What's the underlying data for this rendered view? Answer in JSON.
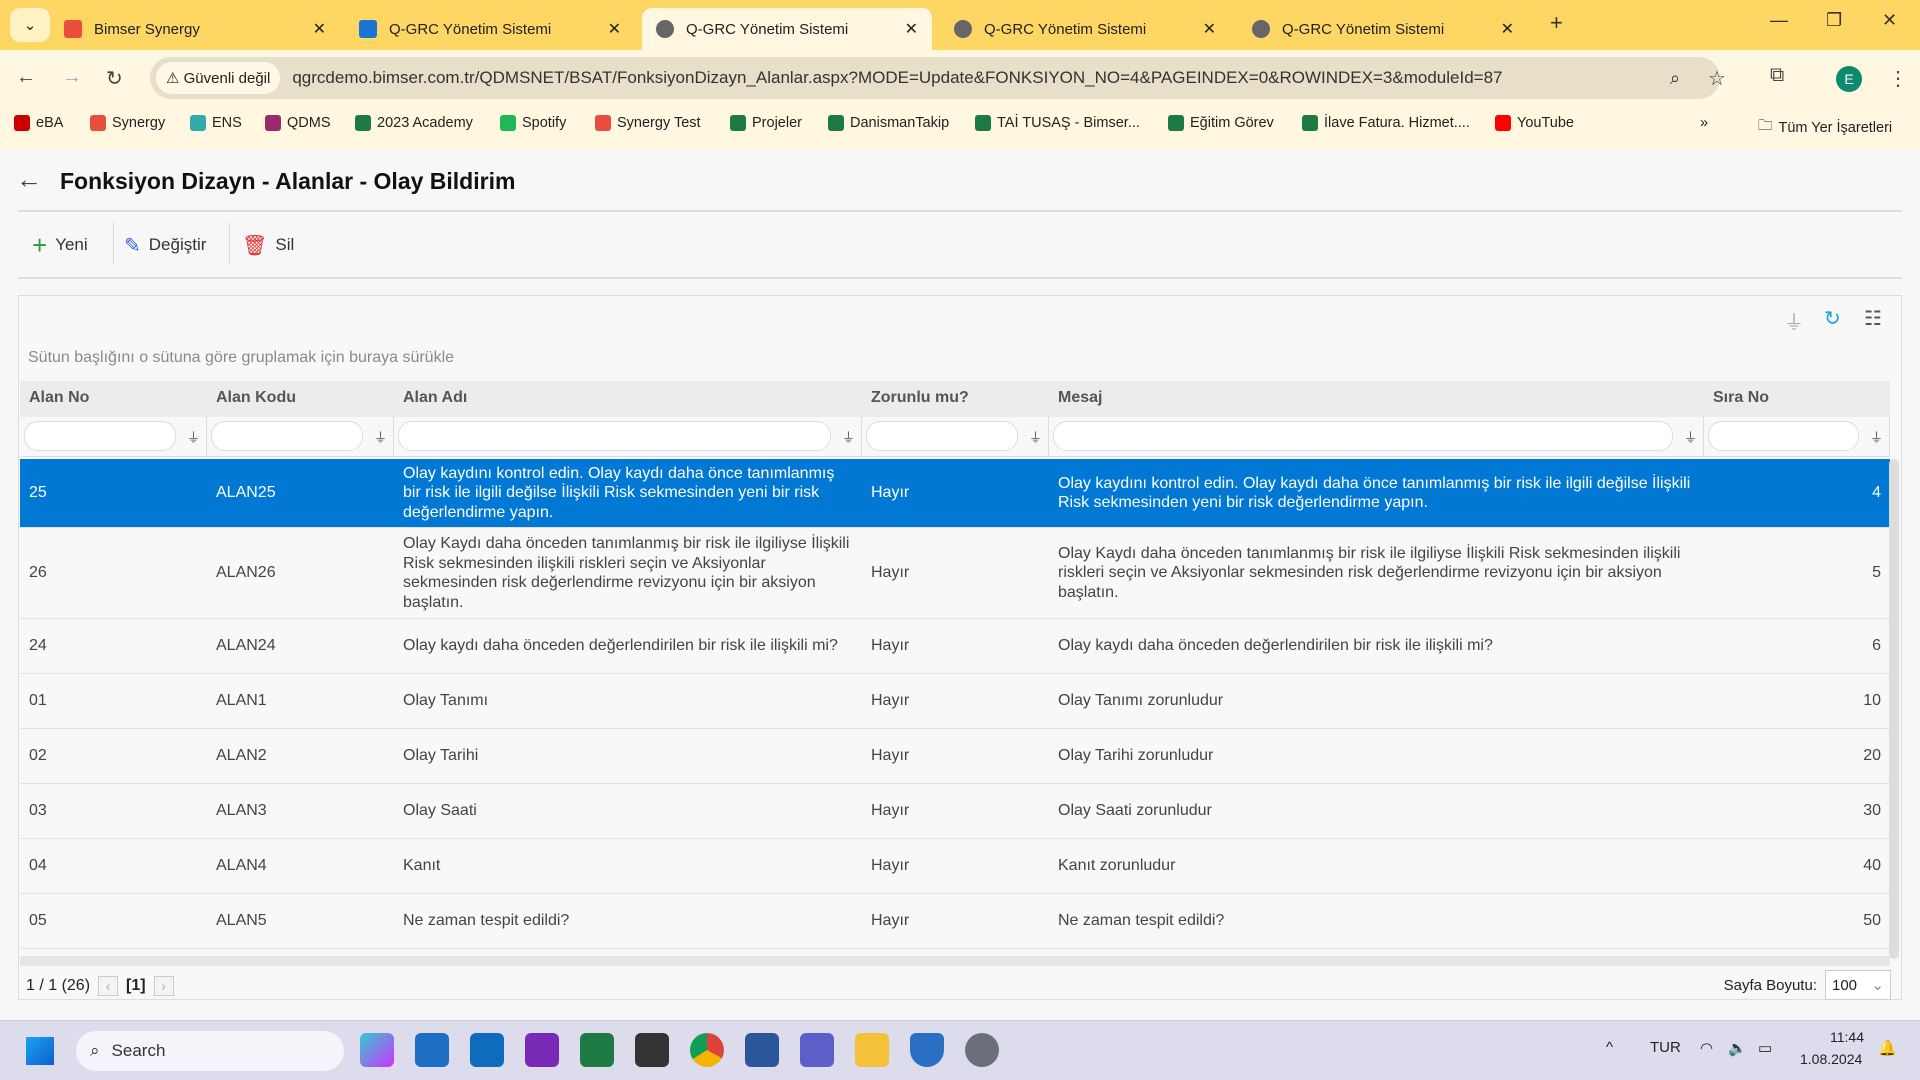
{
  "browser": {
    "tabs": [
      {
        "label": "Bimser Synergy",
        "icon": "synergy-icon",
        "active": false
      },
      {
        "label": "Q-GRC Yönetim Sistemi",
        "icon": "qgrc-icon",
        "active": false
      },
      {
        "label": "Q-GRC Yönetim Sistemi",
        "icon": "globe-icon",
        "active": true
      },
      {
        "label": "Q-GRC Yönetim Sistemi",
        "icon": "globe-icon",
        "active": false
      },
      {
        "label": "Q-GRC Yönetim Sistemi",
        "icon": "globe-icon",
        "active": false
      }
    ],
    "security_label": "Güvenli değil",
    "url": "qgrcdemo.bimser.com.tr/QDMSNET/BSAT/FonksiyonDizayn_Alanlar.aspx?MODE=Update&FONKSIYON_NO=4&PAGEINDEX=0&ROWINDEX=3&moduleId=87",
    "profile_initial": "E",
    "bookmarks": [
      "eBA",
      "Synergy",
      "ENS",
      "QDMS",
      "2023 Academy",
      "Spotify",
      "Synergy Test",
      "Projeler",
      "DanismanTakip",
      "TAİ TUSAŞ - Bimser...",
      "Eğitim Görev",
      "İlave Fatura. Hizmet....",
      "YouTube"
    ],
    "all_bookmarks": "Tüm Yer İşaretleri"
  },
  "page": {
    "title": "Fonksiyon Dizayn - Alanlar - Olay Bildirim",
    "toolbar": {
      "new": "Yeni",
      "edit": "Değiştir",
      "delete": "Sil"
    },
    "group_hint": "Sütun başlığını o sütuna göre gruplamak için buraya sürükle"
  },
  "table": {
    "columns": [
      "Alan No",
      "Alan Kodu",
      "Alan Adı",
      "Zorunlu mu?",
      "Mesaj",
      "Sıra No"
    ],
    "rows": [
      [
        "25",
        "ALAN25",
        "Olay kaydını kontrol edin. Olay kaydı daha önce tanımlanmış bir risk ile ilgili değilse İlişkili Risk sekmesinden yeni bir risk değerlendirme yapın.",
        "Hayır",
        "Olay kaydını kontrol edin. Olay kaydı daha önce tanımlanmış bir risk ile ilgili değilse İlişkili Risk sekmesinden yeni bir risk değerlendirme yapın.",
        "4"
      ],
      [
        "26",
        "ALAN26",
        "Olay Kaydı daha önceden tanımlanmış bir risk ile ilgiliyse İlişkili Risk sekmesinden ilişkili riskleri seçin ve Aksiyonlar sekmesinden risk değerlendirme revizyonu için bir aksiyon başlatın.",
        "Hayır",
        "Olay Kaydı daha önceden tanımlanmış bir risk ile ilgiliyse İlişkili Risk sekmesinden ilişkili riskleri seçin ve Aksiyonlar sekmesinden risk değerlendirme revizyonu için bir aksiyon başlatın.",
        "5"
      ],
      [
        "24",
        "ALAN24",
        "Olay kaydı daha önceden değerlendirilen bir risk ile ilişkili mi?",
        "Hayır",
        "Olay kaydı daha önceden değerlendirilen bir risk ile ilişkili mi?",
        "6"
      ],
      [
        "01",
        "ALAN1",
        "Olay Tanımı",
        "Hayır",
        "Olay Tanımı zorunludur",
        "10"
      ],
      [
        "02",
        "ALAN2",
        "Olay Tarihi",
        "Hayır",
        "Olay Tarihi zorunludur",
        "20"
      ],
      [
        "03",
        "ALAN3",
        "Olay Saati",
        "Hayır",
        "Olay Saati zorunludur",
        "30"
      ],
      [
        "04",
        "ALAN4",
        "Kanıt",
        "Hayır",
        "Kanıt zorunludur",
        "40"
      ],
      [
        "05",
        "ALAN5",
        "Ne zaman tespit edildi?",
        "Hayır",
        "Ne zaman tespit edildi?",
        "50"
      ]
    ],
    "selected_row": 0,
    "pager": {
      "summary": "1 / 1 (26)",
      "current": "[1]",
      "page_size_label": "Sayfa Boyutu:",
      "page_size": "100"
    }
  },
  "taskbar": {
    "search": "Search",
    "lang": "TUR",
    "time": "11:44",
    "date": "1.08.2024"
  },
  "colors": {
    "accent": "#0078d4",
    "tabbar": "#fdd663"
  }
}
